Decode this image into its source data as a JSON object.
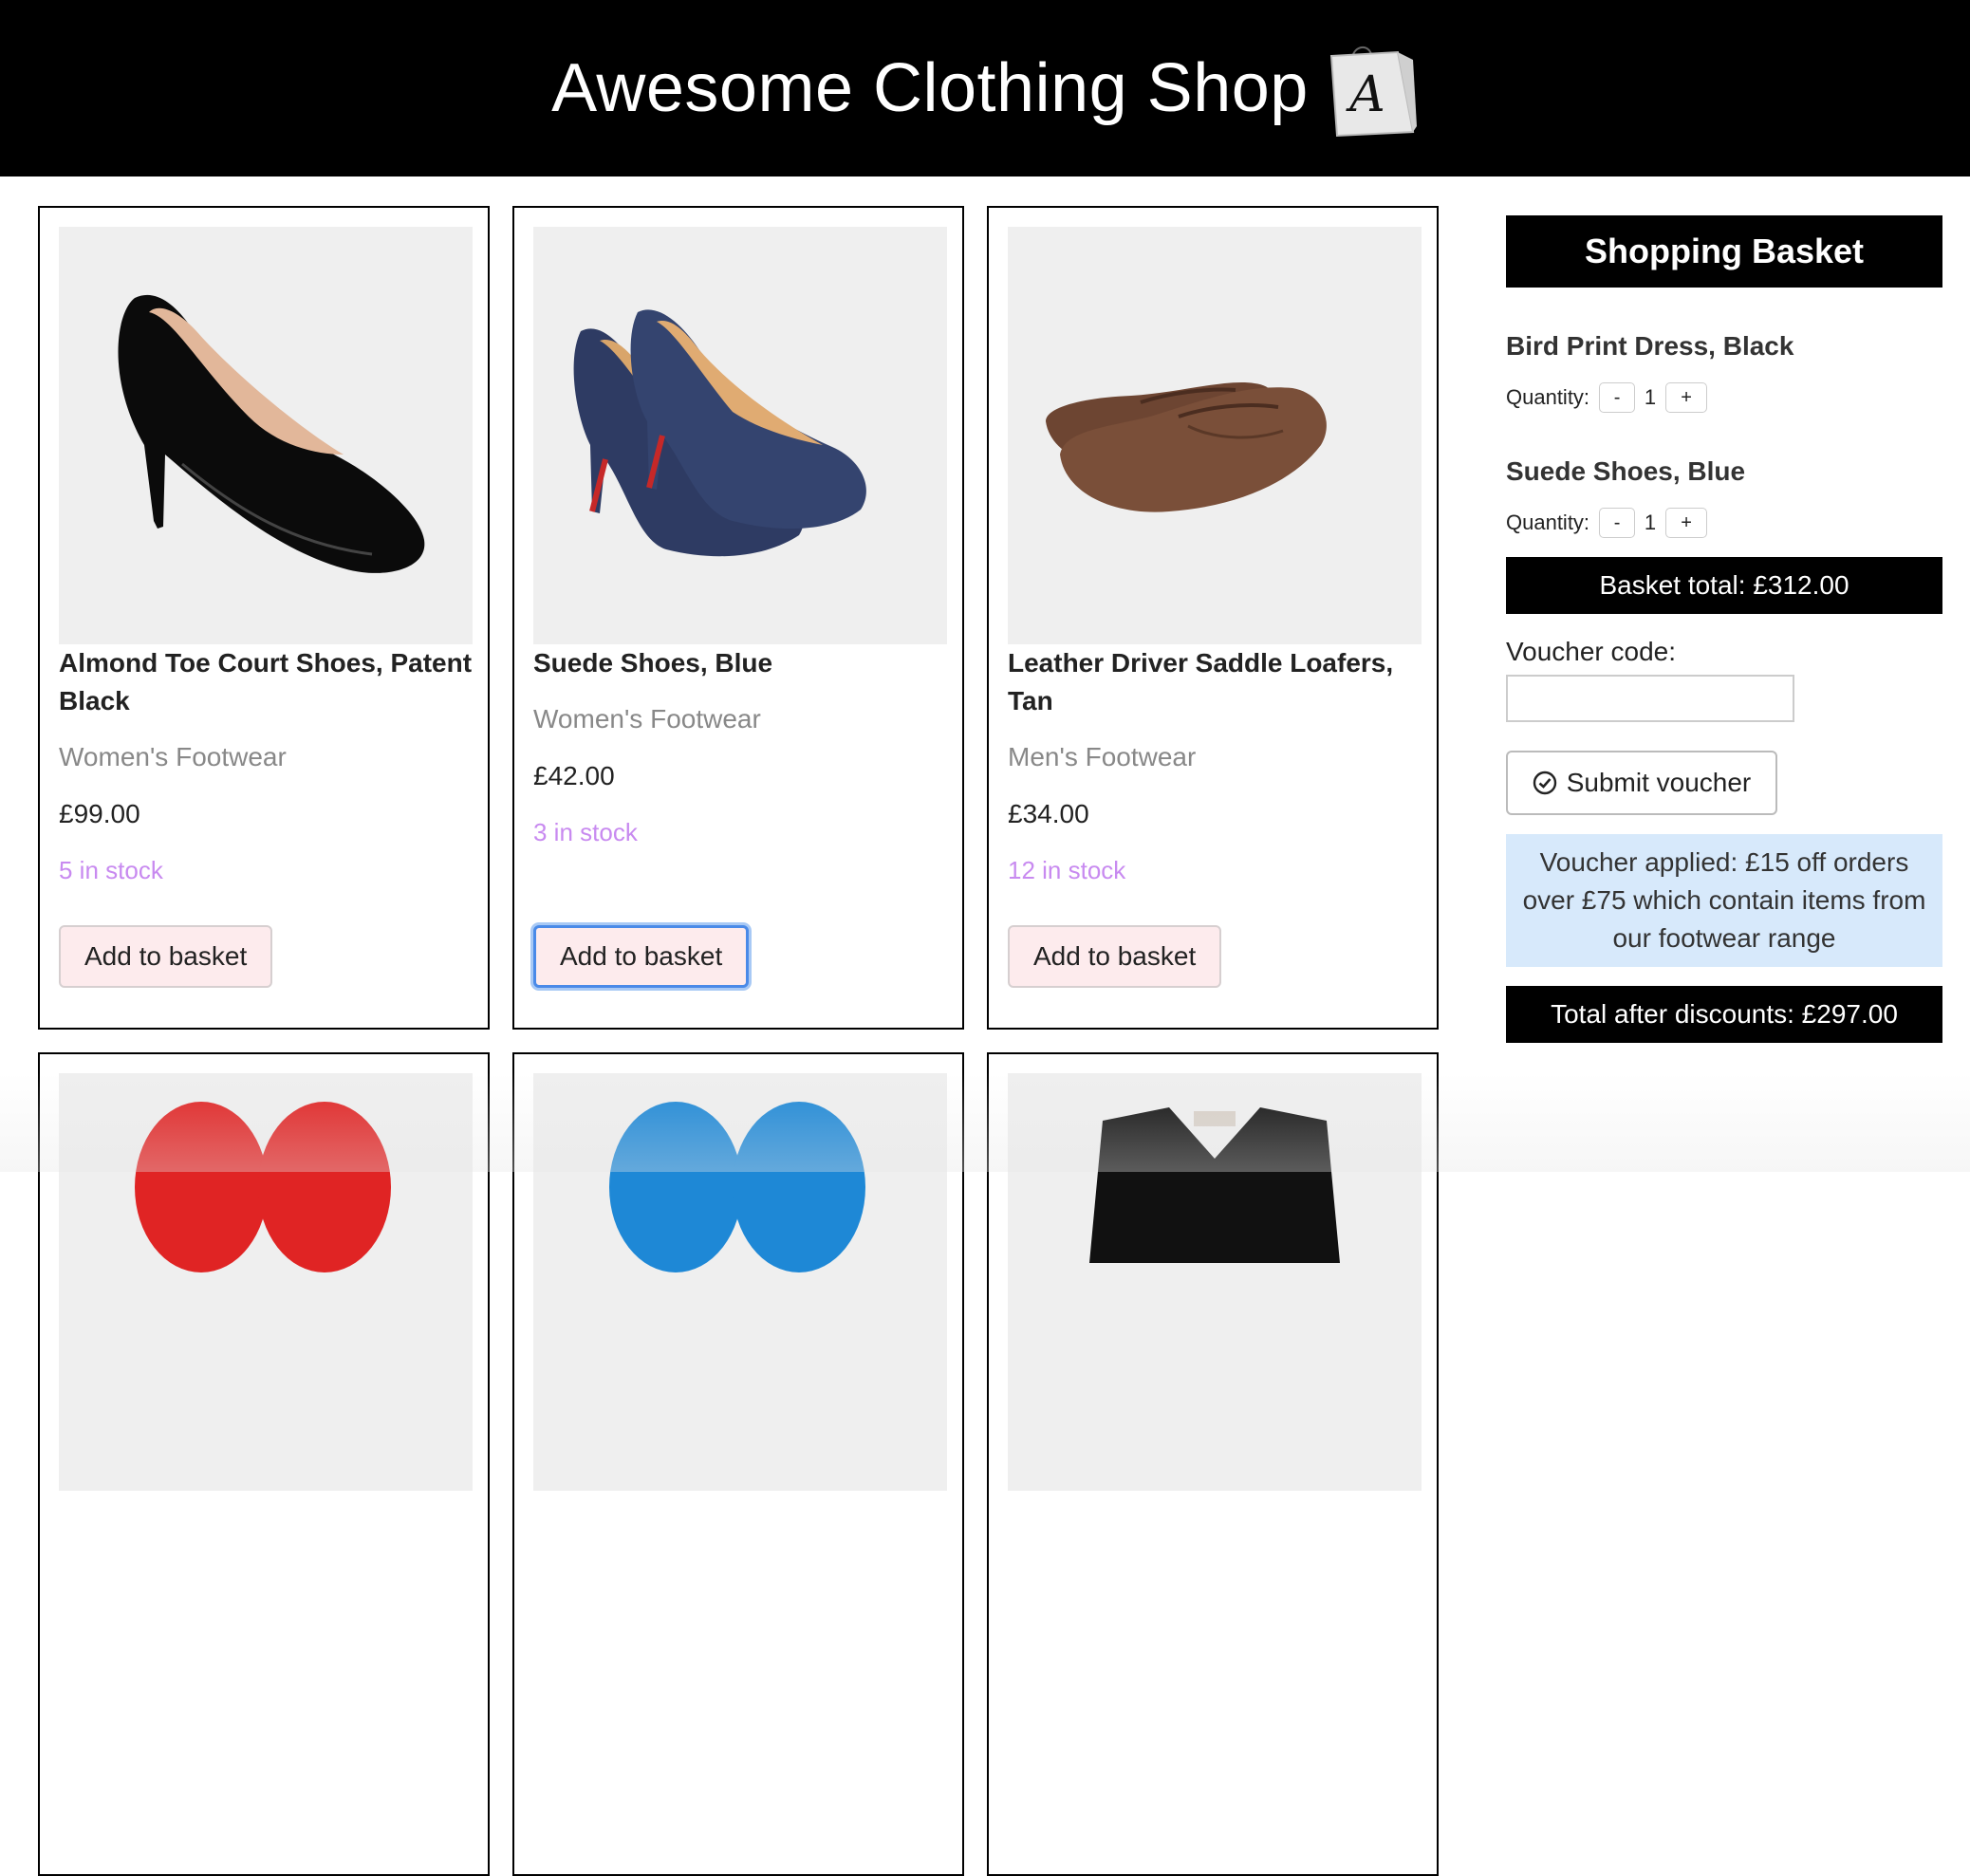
{
  "header": {
    "title": "Awesome Clothing Shop",
    "logo_icon": "shopping-bag-icon",
    "logo_letter": "A"
  },
  "products": [
    {
      "name": "Almond Toe Court Shoes, Patent Black",
      "category": "Women's Footwear",
      "price": "£99.00",
      "stock": "5 in stock",
      "button": "Add to basket",
      "image": "black-patent-court-shoe"
    },
    {
      "name": "Suede Shoes, Blue",
      "category": "Women's Footwear",
      "price": "£42.00",
      "stock": "3 in stock",
      "button": "Add to basket",
      "image": "blue-suede-pump"
    },
    {
      "name": "Leather Driver Saddle Loafers, Tan",
      "category": "Men's Footwear",
      "price": "£34.00",
      "stock": "12 in stock",
      "button": "Add to basket",
      "image": "tan-loafers"
    },
    {
      "image": "red-flip-flops"
    },
    {
      "image": "blue-flip-flops"
    },
    {
      "image": "black-cardigan"
    }
  ],
  "basket": {
    "title": "Shopping Basket",
    "items": [
      {
        "name": "Bird Print Dress, Black",
        "quantity_label": "Quantity:",
        "quantity": "1",
        "minus": "-",
        "plus": "+"
      },
      {
        "name": "Suede Shoes, Blue",
        "quantity_label": "Quantity:",
        "quantity": "1",
        "minus": "-",
        "plus": "+"
      }
    ],
    "total": "Basket total: £312.00",
    "voucher_label": "Voucher code:",
    "voucher_value": "",
    "submit_label": "Submit voucher",
    "voucher_message": "Voucher applied: £15 off orders over £75 which contain items from our footwear range",
    "after_total": "Total after discounts: £297.00"
  },
  "colors": {
    "header_bg": "#000000",
    "stock_text": "#c88af0",
    "category_text": "#888888",
    "add_button_bg": "#fdebed",
    "voucher_message_bg": "#d7e9fb",
    "focus_ring": "#4a8ae8"
  }
}
